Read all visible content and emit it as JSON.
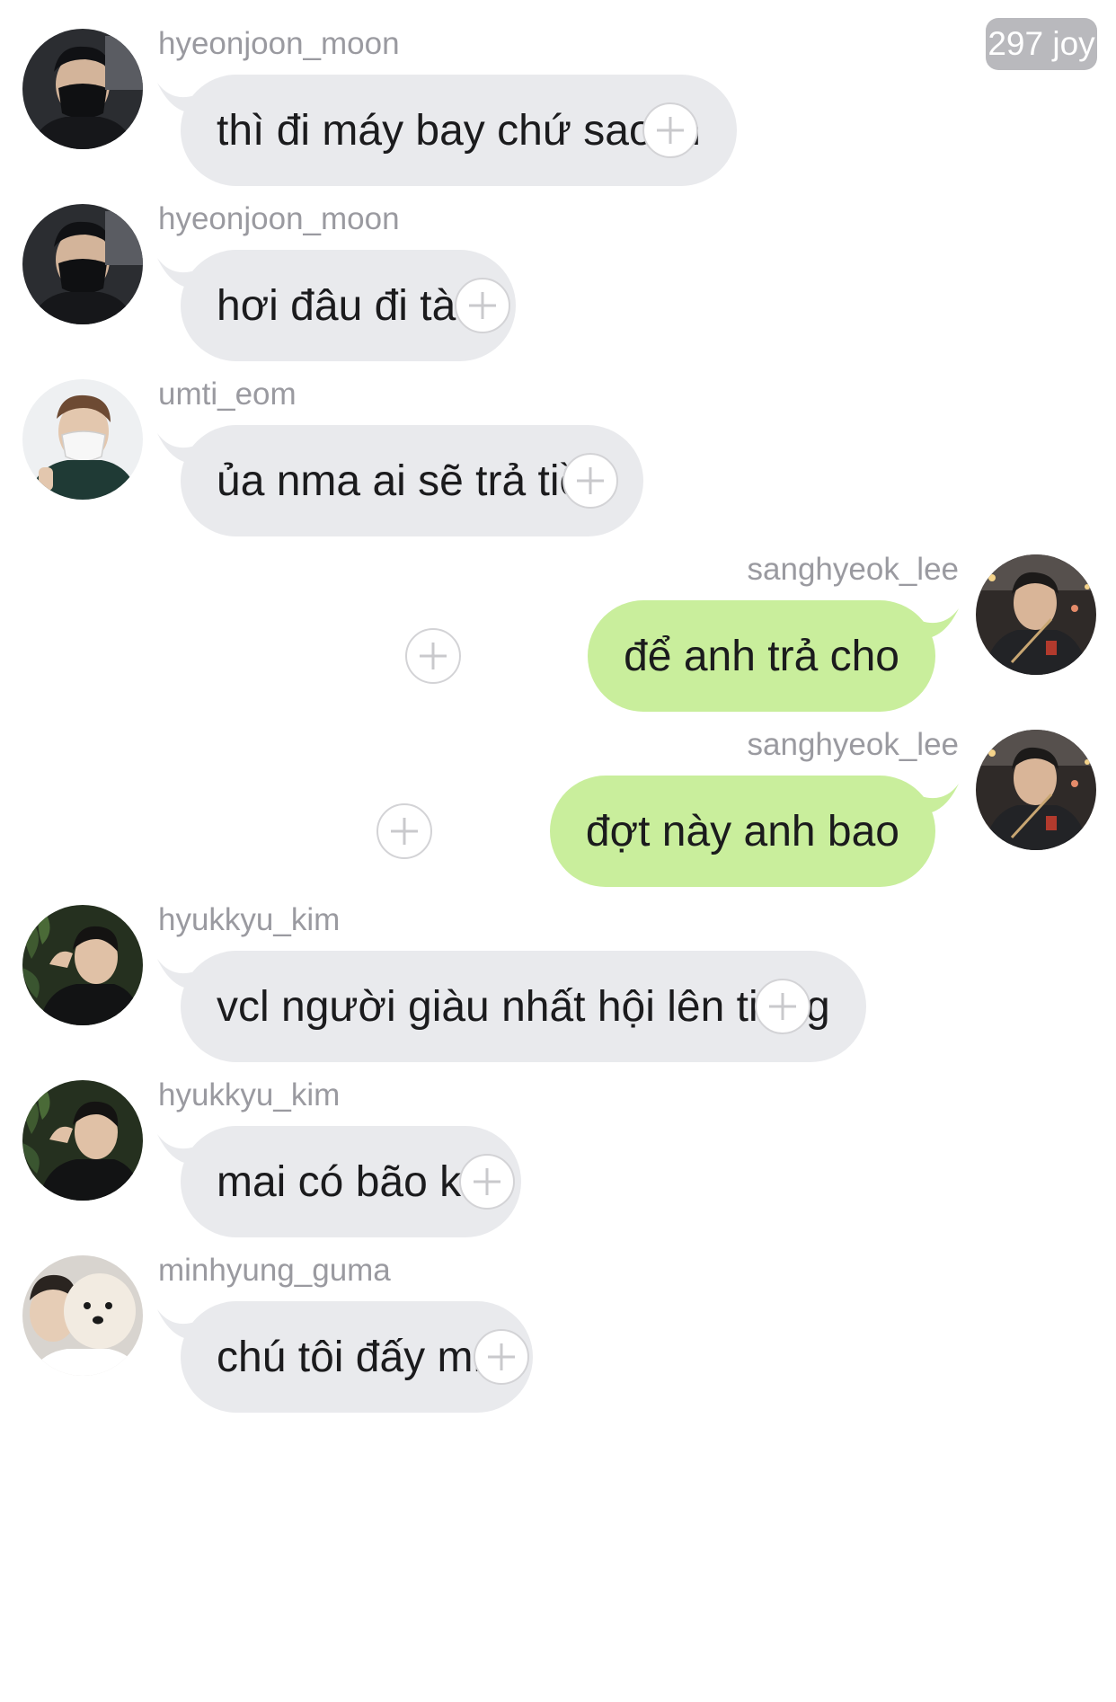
{
  "header": {
    "counter": "297 joy"
  },
  "messages": [
    {
      "direction": "in",
      "username": "hyeonjoon_moon",
      "text": "thì đi máy bay chứ sao m",
      "avatar_icon": "avatar-black-mask-icon"
    },
    {
      "direction": "in",
      "username": "hyeonjoon_moon",
      "text": "hơi đâu đi tàu",
      "avatar_icon": "avatar-black-mask-icon"
    },
    {
      "direction": "in",
      "username": "umti_eom",
      "text": "ủa nma ai sẽ trả tiền",
      "avatar_icon": "avatar-white-mask-icon"
    },
    {
      "direction": "out",
      "username": "sanghyeok_lee",
      "text": "để anh trả cho",
      "avatar_icon": "avatar-night-city-icon"
    },
    {
      "direction": "out",
      "username": "sanghyeok_lee",
      "text": "đợt này anh bao",
      "avatar_icon": "avatar-night-city-icon"
    },
    {
      "direction": "in",
      "username": "hyukkyu_kim",
      "text": "vcl người giàu nhất hội lên tiếng",
      "avatar_icon": "avatar-green-leaves-icon"
    },
    {
      "direction": "in",
      "username": "hyukkyu_kim",
      "text": "mai có bão ko",
      "avatar_icon": "avatar-green-leaves-icon"
    },
    {
      "direction": "in",
      "username": "minhyung_guma",
      "text": "chú tôi đấy mn",
      "avatar_icon": "avatar-white-dog-icon"
    }
  ],
  "colors": {
    "incoming_bubble": "#e9eaed",
    "outgoing_bubble": "#c9ee9c",
    "username_text": "#9a9aa0",
    "message_text": "#1b1b1d",
    "badge_background": "#b9b9bd"
  },
  "icons": {
    "reaction": "add-reaction-icon"
  }
}
